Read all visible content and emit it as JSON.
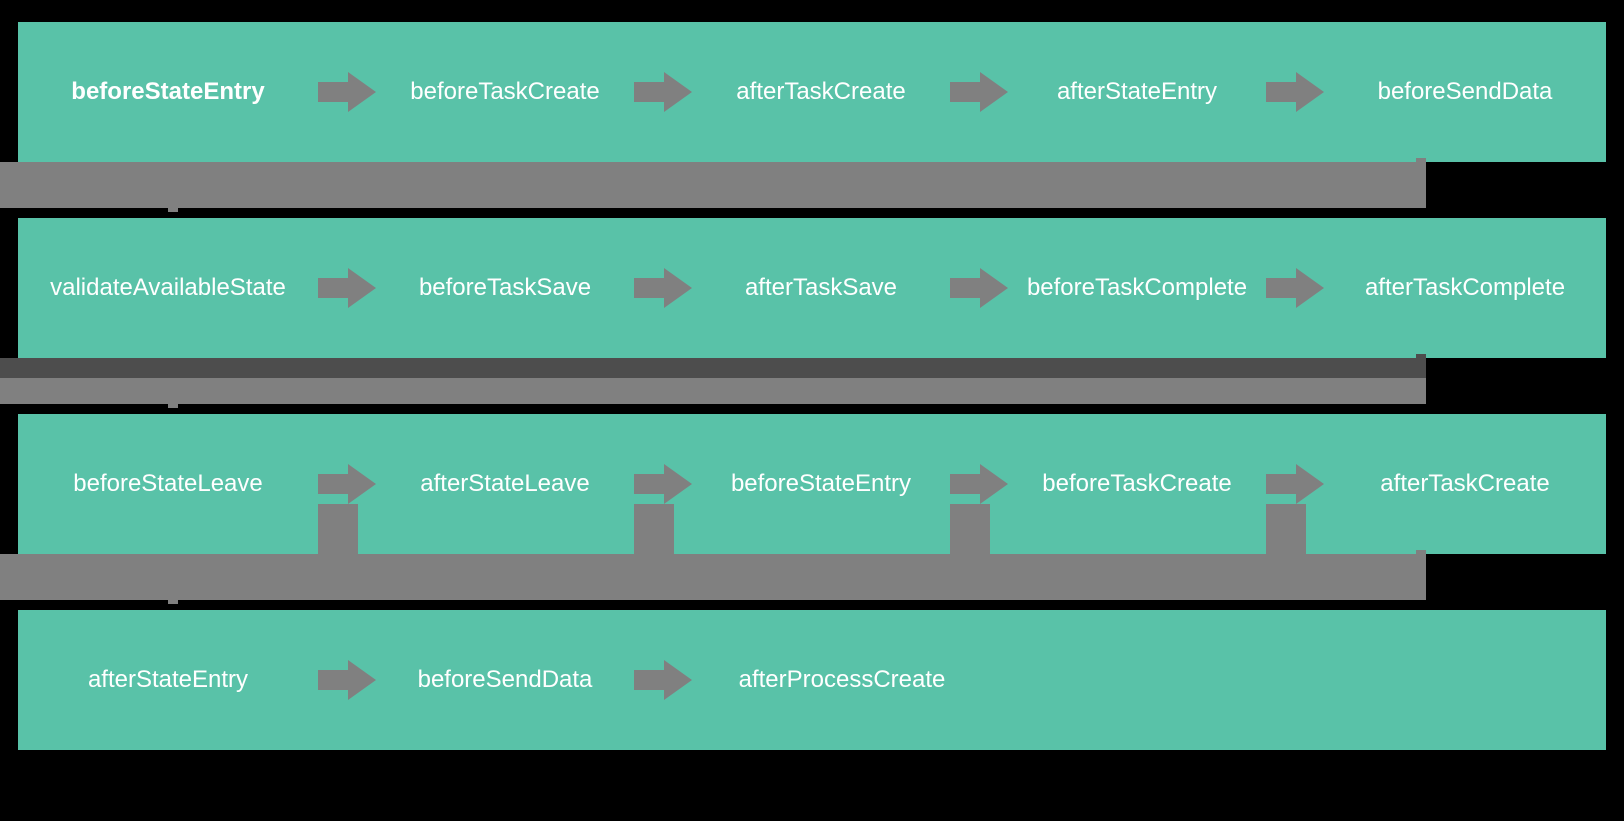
{
  "colors": {
    "teal": "#59c2a8",
    "arrow": "#808080",
    "rowbar": "#808080",
    "darkbar": "#4d4d4d",
    "text": "#ffffff"
  },
  "rows": [
    {
      "items": [
        {
          "label": "beforeStateEntry",
          "bold": true
        },
        {
          "label": "beforeTaskCreate"
        },
        {
          "label": "afterTaskCreate"
        },
        {
          "label": "afterStateEntry"
        },
        {
          "label": "beforeSendData"
        }
      ]
    },
    {
      "items": [
        {
          "label": "validateAvailableState"
        },
        {
          "label": "beforeTaskSave"
        },
        {
          "label": "afterTaskSave"
        },
        {
          "label": "beforeTaskComplete"
        },
        {
          "label": "afterTaskComplete"
        }
      ]
    },
    {
      "items": [
        {
          "label": "beforeStateLeave"
        },
        {
          "label": "afterStateLeave"
        },
        {
          "label": "beforeStateEntry"
        },
        {
          "label": "beforeTaskCreate"
        },
        {
          "label": "afterTaskCreate"
        }
      ]
    },
    {
      "items": [
        {
          "label": "afterStateEntry"
        },
        {
          "label": "beforeSendData"
        },
        {
          "label": "afterProcessCreate"
        }
      ]
    }
  ]
}
